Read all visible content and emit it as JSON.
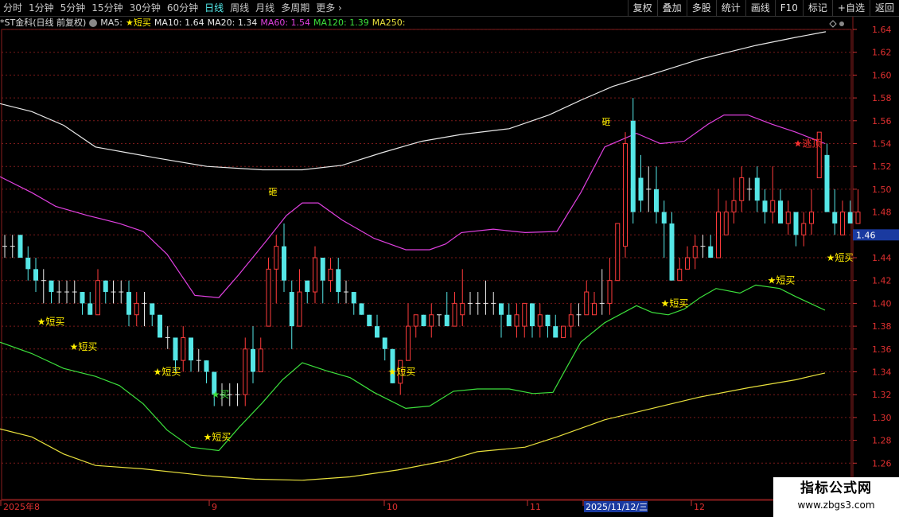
{
  "toolbar": {
    "periods": [
      "分时",
      "1分钟",
      "5分钟",
      "15分钟",
      "30分钟",
      "60分钟",
      "日线",
      "周线",
      "月线",
      "多周期",
      "更多 ›"
    ],
    "active_index": 6,
    "buttons": [
      "复权",
      "叠加",
      "多股",
      "统计",
      "画线",
      "F10",
      "标记",
      "+自选",
      "返回"
    ]
  },
  "info": {
    "stock": "*ST金科(日线 前复权)",
    "ma5_label": "MA5:",
    "ma5_value": "★短买",
    "ma10": "MA10: 1.64",
    "ma20": "MA20: 1.34",
    "ma60": "MA60: 1.54",
    "ma120": "MA120: 1.39",
    "ma250": "MA250:"
  },
  "colors": {
    "up": "#ff3b3b",
    "down": "#55e6e6",
    "white_line": "#e8e8e8",
    "magenta_line": "#e040e0",
    "green_line": "#3ce03c",
    "yellow_line": "#e8e03c",
    "signal": "#ffee00",
    "grid": "#7a1a1a"
  },
  "axis": {
    "price_labels": [
      "1.64",
      "1.62",
      "1.60",
      "1.58",
      "1.56",
      "1.54",
      "1.52",
      "1.50",
      "1.48",
      "1.46",
      "1.44",
      "1.42",
      "1.40",
      "1.38",
      "1.36",
      "1.34",
      "1.32",
      "1.30",
      "1.28",
      "1.26"
    ],
    "current_price": "1.46",
    "date_labels": [
      "2025年8",
      "9",
      "10",
      "11",
      "2025/11/12/三",
      "12"
    ]
  },
  "chart_data": {
    "type": "candlestick",
    "ylim": [
      1.245,
      1.655
    ],
    "candles": [
      {
        "o": 1.45,
        "h": 1.46,
        "l": 1.44,
        "c": 1.45
      },
      {
        "o": 1.45,
        "h": 1.46,
        "l": 1.44,
        "c": 1.45
      },
      {
        "o": 1.46,
        "h": 1.46,
        "l": 1.44,
        "c": 1.44
      },
      {
        "o": 1.44,
        "h": 1.45,
        "l": 1.42,
        "c": 1.43
      },
      {
        "o": 1.43,
        "h": 1.44,
        "l": 1.41,
        "c": 1.42
      },
      {
        "o": 1.42,
        "h": 1.43,
        "l": 1.4,
        "c": 1.42
      },
      {
        "o": 1.42,
        "h": 1.42,
        "l": 1.4,
        "c": 1.41
      },
      {
        "o": 1.41,
        "h": 1.42,
        "l": 1.4,
        "c": 1.41
      },
      {
        "o": 1.41,
        "h": 1.42,
        "l": 1.4,
        "c": 1.41
      },
      {
        "o": 1.41,
        "h": 1.42,
        "l": 1.4,
        "c": 1.41
      },
      {
        "o": 1.41,
        "h": 1.41,
        "l": 1.39,
        "c": 1.4
      },
      {
        "o": 1.4,
        "h": 1.41,
        "l": 1.39,
        "c": 1.39
      },
      {
        "o": 1.39,
        "h": 1.43,
        "l": 1.39,
        "c": 1.42
      },
      {
        "o": 1.42,
        "h": 1.42,
        "l": 1.4,
        "c": 1.41
      },
      {
        "o": 1.41,
        "h": 1.42,
        "l": 1.4,
        "c": 1.41
      },
      {
        "o": 1.41,
        "h": 1.42,
        "l": 1.4,
        "c": 1.41
      },
      {
        "o": 1.41,
        "h": 1.42,
        "l": 1.38,
        "c": 1.39
      },
      {
        "o": 1.39,
        "h": 1.41,
        "l": 1.38,
        "c": 1.4
      },
      {
        "o": 1.4,
        "h": 1.41,
        "l": 1.38,
        "c": 1.4
      },
      {
        "o": 1.4,
        "h": 1.4,
        "l": 1.38,
        "c": 1.39
      },
      {
        "o": 1.39,
        "h": 1.39,
        "l": 1.37,
        "c": 1.37
      },
      {
        "o": 1.37,
        "h": 1.38,
        "l": 1.36,
        "c": 1.37
      },
      {
        "o": 1.37,
        "h": 1.37,
        "l": 1.34,
        "c": 1.35
      },
      {
        "o": 1.35,
        "h": 1.38,
        "l": 1.34,
        "c": 1.37
      },
      {
        "o": 1.37,
        "h": 1.37,
        "l": 1.34,
        "c": 1.35
      },
      {
        "o": 1.35,
        "h": 1.36,
        "l": 1.34,
        "c": 1.35
      },
      {
        "o": 1.35,
        "h": 1.35,
        "l": 1.33,
        "c": 1.34
      },
      {
        "o": 1.34,
        "h": 1.34,
        "l": 1.31,
        "c": 1.32
      },
      {
        "o": 1.32,
        "h": 1.33,
        "l": 1.31,
        "c": 1.32
      },
      {
        "o": 1.32,
        "h": 1.33,
        "l": 1.31,
        "c": 1.32
      },
      {
        "o": 1.32,
        "h": 1.33,
        "l": 1.31,
        "c": 1.32
      },
      {
        "o": 1.32,
        "h": 1.37,
        "l": 1.31,
        "c": 1.36
      },
      {
        "o": 1.36,
        "h": 1.38,
        "l": 1.33,
        "c": 1.34
      },
      {
        "o": 1.34,
        "h": 1.37,
        "l": 1.34,
        "c": 1.36
      },
      {
        "o": 1.38,
        "h": 1.44,
        "l": 1.38,
        "c": 1.43
      },
      {
        "o": 1.43,
        "h": 1.46,
        "l": 1.4,
        "c": 1.45
      },
      {
        "o": 1.45,
        "h": 1.47,
        "l": 1.41,
        "c": 1.42
      },
      {
        "o": 1.41,
        "h": 1.42,
        "l": 1.36,
        "c": 1.38
      },
      {
        "o": 1.38,
        "h": 1.43,
        "l": 1.38,
        "c": 1.41
      },
      {
        "o": 1.42,
        "h": 1.42,
        "l": 1.4,
        "c": 1.41
      },
      {
        "o": 1.41,
        "h": 1.45,
        "l": 1.4,
        "c": 1.44
      },
      {
        "o": 1.44,
        "h": 1.44,
        "l": 1.4,
        "c": 1.42
      },
      {
        "o": 1.42,
        "h": 1.44,
        "l": 1.41,
        "c": 1.43
      },
      {
        "o": 1.43,
        "h": 1.44,
        "l": 1.4,
        "c": 1.41
      },
      {
        "o": 1.41,
        "h": 1.42,
        "l": 1.4,
        "c": 1.41
      },
      {
        "o": 1.41,
        "h": 1.41,
        "l": 1.39,
        "c": 1.4
      },
      {
        "o": 1.4,
        "h": 1.4,
        "l": 1.39,
        "c": 1.39
      },
      {
        "o": 1.39,
        "h": 1.39,
        "l": 1.38,
        "c": 1.38
      },
      {
        "o": 1.38,
        "h": 1.39,
        "l": 1.37,
        "c": 1.37
      },
      {
        "o": 1.37,
        "h": 1.37,
        "l": 1.35,
        "c": 1.36
      },
      {
        "o": 1.36,
        "h": 1.36,
        "l": 1.33,
        "c": 1.33
      },
      {
        "o": 1.33,
        "h": 1.35,
        "l": 1.32,
        "c": 1.35
      },
      {
        "o": 1.35,
        "h": 1.4,
        "l": 1.35,
        "c": 1.38
      },
      {
        "o": 1.38,
        "h": 1.39,
        "l": 1.37,
        "c": 1.39
      },
      {
        "o": 1.39,
        "h": 1.39,
        "l": 1.38,
        "c": 1.38
      },
      {
        "o": 1.38,
        "h": 1.4,
        "l": 1.37,
        "c": 1.39
      },
      {
        "o": 1.39,
        "h": 1.39,
        "l": 1.38,
        "c": 1.39
      },
      {
        "o": 1.39,
        "h": 1.41,
        "l": 1.38,
        "c": 1.38
      },
      {
        "o": 1.38,
        "h": 1.41,
        "l": 1.38,
        "c": 1.4
      },
      {
        "o": 1.39,
        "h": 1.43,
        "l": 1.38,
        "c": 1.4
      },
      {
        "o": 1.4,
        "h": 1.41,
        "l": 1.39,
        "c": 1.4
      },
      {
        "o": 1.4,
        "h": 1.41,
        "l": 1.39,
        "c": 1.4
      },
      {
        "o": 1.4,
        "h": 1.42,
        "l": 1.39,
        "c": 1.4
      },
      {
        "o": 1.4,
        "h": 1.41,
        "l": 1.39,
        "c": 1.4
      },
      {
        "o": 1.4,
        "h": 1.4,
        "l": 1.37,
        "c": 1.39
      },
      {
        "o": 1.39,
        "h": 1.4,
        "l": 1.38,
        "c": 1.38
      },
      {
        "o": 1.38,
        "h": 1.4,
        "l": 1.37,
        "c": 1.39
      },
      {
        "o": 1.38,
        "h": 1.4,
        "l": 1.37,
        "c": 1.4
      },
      {
        "o": 1.4,
        "h": 1.4,
        "l": 1.37,
        "c": 1.38
      },
      {
        "o": 1.38,
        "h": 1.4,
        "l": 1.37,
        "c": 1.39
      },
      {
        "o": 1.39,
        "h": 1.39,
        "l": 1.37,
        "c": 1.38
      },
      {
        "o": 1.38,
        "h": 1.39,
        "l": 1.37,
        "c": 1.37
      },
      {
        "o": 1.37,
        "h": 1.38,
        "l": 1.37,
        "c": 1.38
      },
      {
        "o": 1.38,
        "h": 1.4,
        "l": 1.37,
        "c": 1.39
      },
      {
        "o": 1.39,
        "h": 1.4,
        "l": 1.38,
        "c": 1.39
      },
      {
        "o": 1.39,
        "h": 1.42,
        "l": 1.39,
        "c": 1.41
      },
      {
        "o": 1.39,
        "h": 1.41,
        "l": 1.39,
        "c": 1.4
      },
      {
        "o": 1.4,
        "h": 1.43,
        "l": 1.39,
        "c": 1.4
      },
      {
        "o": 1.4,
        "h": 1.44,
        "l": 1.39,
        "c": 1.42
      },
      {
        "o": 1.42,
        "h": 1.47,
        "l": 1.42,
        "c": 1.47
      },
      {
        "o": 1.45,
        "h": 1.55,
        "l": 1.44,
        "c": 1.54
      },
      {
        "o": 1.56,
        "h": 1.58,
        "l": 1.47,
        "c": 1.48
      },
      {
        "o": 1.51,
        "h": 1.53,
        "l": 1.48,
        "c": 1.49
      },
      {
        "o": 1.5,
        "h": 1.52,
        "l": 1.48,
        "c": 1.5
      },
      {
        "o": 1.5,
        "h": 1.52,
        "l": 1.47,
        "c": 1.48
      },
      {
        "o": 1.48,
        "h": 1.49,
        "l": 1.44,
        "c": 1.47
      },
      {
        "o": 1.47,
        "h": 1.48,
        "l": 1.42,
        "c": 1.42
      },
      {
        "o": 1.42,
        "h": 1.44,
        "l": 1.42,
        "c": 1.43
      },
      {
        "o": 1.43,
        "h": 1.45,
        "l": 1.43,
        "c": 1.44
      },
      {
        "o": 1.44,
        "h": 1.46,
        "l": 1.43,
        "c": 1.45
      },
      {
        "o": 1.45,
        "h": 1.46,
        "l": 1.44,
        "c": 1.45
      },
      {
        "o": 1.45,
        "h": 1.46,
        "l": 1.44,
        "c": 1.44
      },
      {
        "o": 1.44,
        "h": 1.5,
        "l": 1.44,
        "c": 1.48
      },
      {
        "o": 1.46,
        "h": 1.49,
        "l": 1.46,
        "c": 1.48
      },
      {
        "o": 1.48,
        "h": 1.51,
        "l": 1.47,
        "c": 1.49
      },
      {
        "o": 1.49,
        "h": 1.52,
        "l": 1.48,
        "c": 1.51
      },
      {
        "o": 1.5,
        "h": 1.51,
        "l": 1.49,
        "c": 1.5
      },
      {
        "o": 1.51,
        "h": 1.52,
        "l": 1.48,
        "c": 1.49
      },
      {
        "o": 1.49,
        "h": 1.5,
        "l": 1.47,
        "c": 1.48
      },
      {
        "o": 1.48,
        "h": 1.52,
        "l": 1.47,
        "c": 1.49
      },
      {
        "o": 1.49,
        "h": 1.5,
        "l": 1.47,
        "c": 1.47
      },
      {
        "o": 1.47,
        "h": 1.49,
        "l": 1.46,
        "c": 1.48
      },
      {
        "o": 1.48,
        "h": 1.48,
        "l": 1.45,
        "c": 1.46
      },
      {
        "o": 1.46,
        "h": 1.48,
        "l": 1.45,
        "c": 1.47
      },
      {
        "o": 1.47,
        "h": 1.5,
        "l": 1.46,
        "c": 1.48
      },
      {
        "o": 1.51,
        "h": 1.55,
        "l": 1.51,
        "c": 1.55
      },
      {
        "o": 1.53,
        "h": 1.54,
        "l": 1.48,
        "c": 1.48
      },
      {
        "o": 1.48,
        "h": 1.5,
        "l": 1.46,
        "c": 1.47
      },
      {
        "o": 1.46,
        "h": 1.49,
        "l": 1.46,
        "c": 1.48
      },
      {
        "o": 1.48,
        "h": 1.49,
        "l": 1.47,
        "c": 1.47
      },
      {
        "o": 1.47,
        "h": 1.5,
        "l": 1.47,
        "c": 1.48
      }
    ],
    "lines": {
      "white": [
        [
          0,
          1.575
        ],
        [
          40,
          1.568
        ],
        [
          80,
          1.556
        ],
        [
          120,
          1.537
        ],
        [
          160,
          1.532
        ],
        [
          200,
          1.527
        ],
        [
          260,
          1.52
        ],
        [
          330,
          1.517
        ],
        [
          380,
          1.517
        ],
        [
          430,
          1.521
        ],
        [
          480,
          1.532
        ],
        [
          530,
          1.542
        ],
        [
          580,
          1.548
        ],
        [
          640,
          1.553
        ],
        [
          690,
          1.565
        ],
        [
          730,
          1.578
        ],
        [
          770,
          1.59
        ],
        [
          830,
          1.603
        ],
        [
          880,
          1.614
        ],
        [
          950,
          1.626
        ],
        [
          1000,
          1.633
        ],
        [
          1038,
          1.638
        ]
      ],
      "magenta": [
        [
          0,
          1.511
        ],
        [
          40,
          1.497
        ],
        [
          70,
          1.485
        ],
        [
          110,
          1.477
        ],
        [
          150,
          1.47
        ],
        [
          180,
          1.463
        ],
        [
          210,
          1.443
        ],
        [
          245,
          1.407
        ],
        [
          275,
          1.405
        ],
        [
          300,
          1.425
        ],
        [
          335,
          1.455
        ],
        [
          360,
          1.477
        ],
        [
          380,
          1.488
        ],
        [
          400,
          1.488
        ],
        [
          430,
          1.473
        ],
        [
          470,
          1.457
        ],
        [
          510,
          1.447
        ],
        [
          540,
          1.447
        ],
        [
          560,
          1.452
        ],
        [
          580,
          1.462
        ],
        [
          620,
          1.465
        ],
        [
          660,
          1.462
        ],
        [
          700,
          1.463
        ],
        [
          730,
          1.497
        ],
        [
          760,
          1.537
        ],
        [
          800,
          1.549
        ],
        [
          830,
          1.54
        ],
        [
          860,
          1.542
        ],
        [
          890,
          1.557
        ],
        [
          910,
          1.565
        ],
        [
          940,
          1.565
        ],
        [
          970,
          1.557
        ],
        [
          1000,
          1.55
        ],
        [
          1037,
          1.54
        ]
      ],
      "green": [
        [
          0,
          1.366
        ],
        [
          40,
          1.356
        ],
        [
          80,
          1.343
        ],
        [
          120,
          1.336
        ],
        [
          150,
          1.328
        ],
        [
          180,
          1.312
        ],
        [
          210,
          1.289
        ],
        [
          240,
          1.274
        ],
        [
          275,
          1.271
        ],
        [
          300,
          1.291
        ],
        [
          330,
          1.313
        ],
        [
          355,
          1.333
        ],
        [
          380,
          1.348
        ],
        [
          410,
          1.341
        ],
        [
          440,
          1.335
        ],
        [
          470,
          1.322
        ],
        [
          510,
          1.308
        ],
        [
          540,
          1.31
        ],
        [
          570,
          1.323
        ],
        [
          600,
          1.325
        ],
        [
          640,
          1.325
        ],
        [
          670,
          1.321
        ],
        [
          695,
          1.322
        ],
        [
          710,
          1.341
        ],
        [
          730,
          1.366
        ],
        [
          760,
          1.383
        ],
        [
          800,
          1.398
        ],
        [
          820,
          1.392
        ],
        [
          840,
          1.39
        ],
        [
          860,
          1.395
        ],
        [
          880,
          1.405
        ],
        [
          900,
          1.413
        ],
        [
          930,
          1.409
        ],
        [
          950,
          1.416
        ],
        [
          980,
          1.413
        ],
        [
          1000,
          1.406
        ],
        [
          1037,
          1.394
        ]
      ],
      "yellow": [
        [
          0,
          1.29
        ],
        [
          40,
          1.283
        ],
        [
          80,
          1.268
        ],
        [
          120,
          1.258
        ],
        [
          180,
          1.255
        ],
        [
          260,
          1.249
        ],
        [
          320,
          1.246
        ],
        [
          380,
          1.245
        ],
        [
          440,
          1.248
        ],
        [
          500,
          1.254
        ],
        [
          560,
          1.262
        ],
        [
          600,
          1.27
        ],
        [
          660,
          1.274
        ],
        [
          700,
          1.283
        ],
        [
          760,
          1.298
        ],
        [
          820,
          1.308
        ],
        [
          880,
          1.318
        ],
        [
          940,
          1.326
        ],
        [
          1000,
          1.333
        ],
        [
          1037,
          1.339
        ]
      ]
    },
    "signals": [
      {
        "x": 64,
        "price": 1.384,
        "text": "★短买"
      },
      {
        "x": 105,
        "price": 1.362,
        "text": "★短买"
      },
      {
        "x": 210,
        "price": 1.34,
        "text": "★短买"
      },
      {
        "x": 273,
        "price": 1.283,
        "text": "★短买"
      },
      {
        "x": 505,
        "price": 1.34,
        "text": "★短买"
      },
      {
        "x": 848,
        "price": 1.4,
        "text": "★短买"
      },
      {
        "x": 982,
        "price": 1.42,
        "text": "★短买"
      },
      {
        "x": 1056,
        "price": 1.44,
        "text": "★短买"
      }
    ],
    "buy_marker": {
      "x": 277,
      "price": 1.32,
      "text": "★买"
    },
    "sell_marker": {
      "x": 1015,
      "price": 1.54,
      "text": "★逃顶"
    },
    "small_marks": [
      {
        "x": 343,
        "price": 1.498,
        "text": "砸"
      },
      {
        "x": 762,
        "price": 1.559,
        "text": "砸"
      }
    ]
  },
  "watermark": {
    "title": "指标公式网",
    "url": "www.zbgs3.com"
  }
}
